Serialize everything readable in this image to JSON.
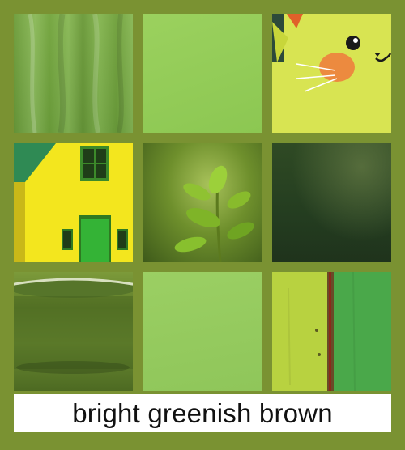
{
  "caption": "bright greenish brown",
  "colors": {
    "frame": "#7a9232",
    "caption_bg": "#ffffff",
    "caption_text": "#111111"
  },
  "tiles": [
    {
      "name": "green-fabric-tile"
    },
    {
      "name": "light-green-swatch-tile"
    },
    {
      "name": "yellow-cat-tile"
    },
    {
      "name": "yellow-house-tile"
    },
    {
      "name": "green-plant-tile"
    },
    {
      "name": "dark-green-texture-tile"
    },
    {
      "name": "green-cup-tile"
    },
    {
      "name": "pale-green-swatch-tile"
    },
    {
      "name": "painted-wood-tile"
    }
  ]
}
